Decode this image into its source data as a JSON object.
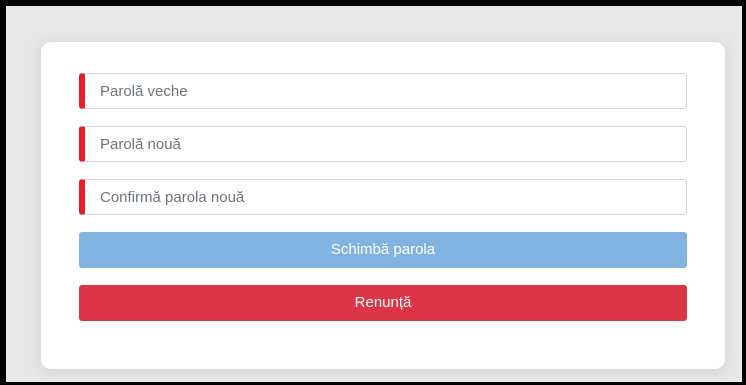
{
  "form": {
    "old_password": {
      "value": "",
      "placeholder": "Parolă veche"
    },
    "new_password": {
      "value": "",
      "placeholder": "Parolă nouă"
    },
    "confirm_password": {
      "value": "",
      "placeholder": "Confirmă parola nouă"
    },
    "change_button_label": "Schimbă parola",
    "cancel_button_label": "Renunță"
  },
  "colors": {
    "required_marker": "#ee1c25",
    "change_button": "#80b3e2",
    "cancel_button": "#dc3545",
    "card_background": "#ffffff",
    "page_background": "#e7e7e8"
  }
}
